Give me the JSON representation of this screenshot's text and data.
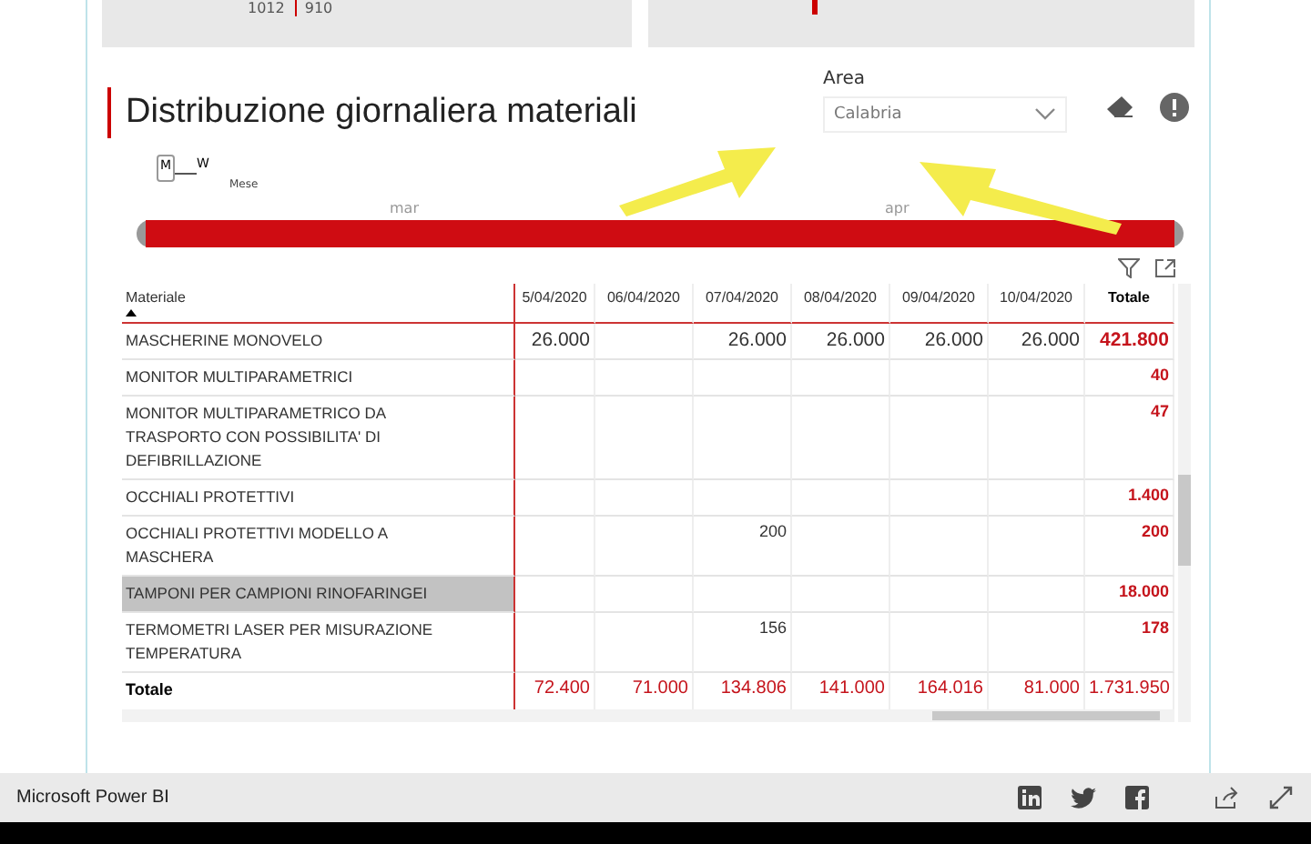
{
  "top_cards": [
    {
      "kind": "numbers",
      "text": "1012",
      "value": "910"
    },
    {
      "kind": "bar"
    }
  ],
  "visual": {
    "title": "Distribuzione giornaliera materiali"
  },
  "area_filter": {
    "label": "Area",
    "value": "Calabria"
  },
  "slicer": {
    "toggle_left": "M",
    "toggle_right": "W",
    "caption": "Mese",
    "months": [
      "mar",
      "apr"
    ],
    "level": 1
  },
  "table": {
    "columns": [
      "Materiale",
      "5/04/2020",
      "06/04/2020",
      "07/04/2020",
      "08/04/2020",
      "09/04/2020",
      "10/04/2020",
      "Totale"
    ],
    "rows": [
      {
        "cells": [
          "MASCHERINE MONOVELO",
          "26.000",
          "",
          "26.000",
          "26.000",
          "26.000",
          "26.000",
          "421.800"
        ],
        "selected": false
      },
      {
        "cells": [
          "MONITOR MULTIPARAMETRICI",
          "",
          "",
          "",
          "",
          "",
          "",
          "40"
        ],
        "selected": false
      },
      {
        "cells": [
          "MONITOR MULTIPARAMETRICO DA TRASPORTO CON POSSIBILITA' DI DEFIBRILLAZIONE",
          "",
          "",
          "",
          "",
          "",
          "",
          "47"
        ],
        "selected": false
      },
      {
        "cells": [
          "OCCHIALI PROTETTIVI",
          "",
          "",
          "",
          "",
          "",
          "",
          "1.400"
        ],
        "selected": false
      },
      {
        "cells": [
          "OCCHIALI PROTETTIVI MODELLO A MASCHERA",
          "",
          "",
          "200",
          "",
          "",
          "",
          "200"
        ],
        "selected": false
      },
      {
        "cells": [
          "TAMPONI PER CAMPIONI RINOFARINGEI",
          "",
          "",
          "",
          "",
          "",
          "",
          "18.000"
        ],
        "selected": true
      },
      {
        "cells": [
          "TERMOMETRI LASER PER MISURAZIONE TEMPERATURA",
          "",
          "",
          "156",
          "",
          "",
          "",
          "178"
        ],
        "selected": false
      }
    ],
    "total": [
      "Totale",
      "72.400",
      "71.000",
      "134.806",
      "141.000",
      "164.016",
      "81.000",
      "1.731.950"
    ]
  },
  "footer": {
    "brand": "Microsoft Power BI"
  }
}
